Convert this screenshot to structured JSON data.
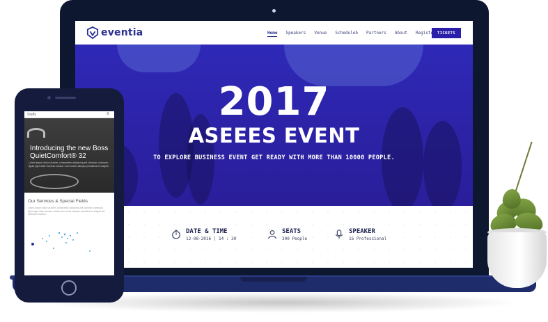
{
  "laptop": {
    "brand": "eventia",
    "nav": [
      "Home",
      "Speakers",
      "Venue",
      "Scheduleb",
      "Partners",
      "About",
      "Register"
    ],
    "tickets_label": "TICKETS",
    "hero": {
      "year": "2017",
      "title": "ASEEES EVENT",
      "subtitle": "TO EXPLORE BUSINESS EVENT GET READY WITH MORE THAN 10000 PEOPLE."
    },
    "info": [
      {
        "icon": "stopwatch-icon",
        "title": "DATE & TIME",
        "value": "12-08-2016  |  14 : 30"
      },
      {
        "icon": "user-icon",
        "title": "SEATS",
        "value": "300 People"
      },
      {
        "icon": "microphone-icon",
        "title": "SPEAKER",
        "value": "16 Professional"
      }
    ]
  },
  "phone": {
    "brand": "Staffy",
    "menu_icon": "hamburger-menu-icon",
    "hero_title": "Introducing the new Boss QuietComfort® 32",
    "hero_text": "Lorem ipsum dolor sit amet, consectetur adipiscing elit. Aenean commodo ligula eget dolor. Aenean massa. Cum sociis natoque penatibus et magnis.",
    "services_title": "Our Services & Special Fields",
    "services_text": "Lorem ipsum dolor sit amet, consectetur adipiscing elit. Aenean commodo ligula eget dolor aenean massa cum sociis natoque penatibus et magnis dis parturient montes."
  },
  "colors": {
    "brand": "#2a2f8f",
    "hero": "#2e27b0",
    "button": "#2a1fa8",
    "device_frame": "#0e1730"
  }
}
